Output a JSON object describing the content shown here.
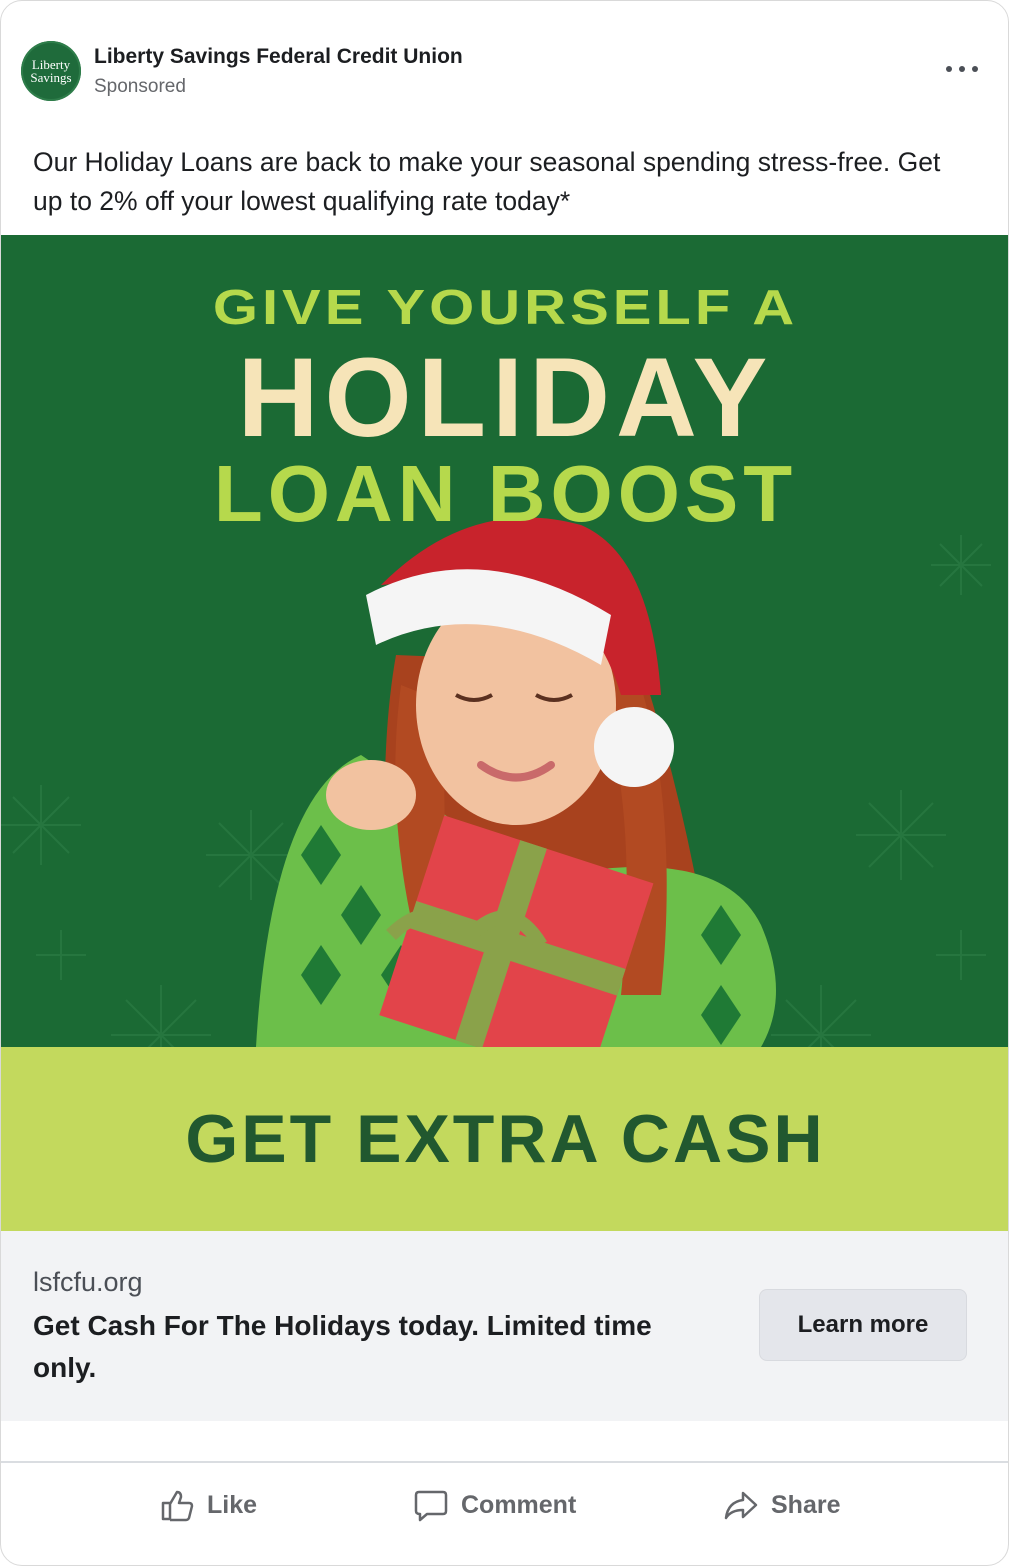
{
  "post": {
    "page_name": "Liberty Savings Federal Credit Union",
    "sponsored_label": "Sponsored",
    "avatar_text_line1": "Liberty",
    "avatar_text_line2": "Savings",
    "body_text": "Our Holiday Loans are back to make your seasonal spending stress-free. Get up to 2% off your lowest qualifying rate today*"
  },
  "creative": {
    "headline_line1": "GIVE YOURSELF A",
    "headline_line2": "HOLIDAY",
    "headline_line3": "LOAN BOOST",
    "banner_text": "GET EXTRA CASH",
    "colors": {
      "background": "#1b6a34",
      "lime": "#b6d94c",
      "cream": "#f6e4b8",
      "banner": "#c3d95d",
      "banner_text": "#21582f"
    }
  },
  "link": {
    "domain": "lsfcfu.org",
    "headline": "Get Cash For The Holidays today. Limited time only.",
    "cta_label": "Learn more"
  },
  "actions": {
    "like_label": "Like",
    "comment_label": "Comment",
    "share_label": "Share",
    "like_icon": "thumbs-up-icon",
    "comment_icon": "speech-bubble-icon",
    "share_icon": "share-arrow-icon"
  }
}
